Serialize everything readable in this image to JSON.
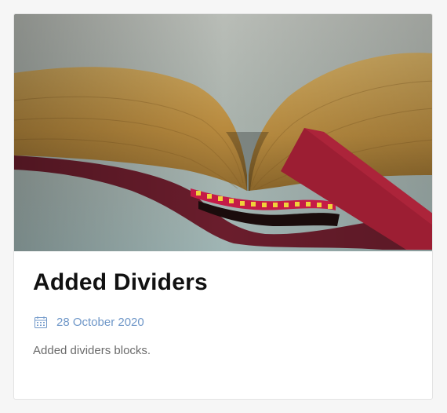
{
  "post": {
    "title": "Added Dividers",
    "date": "28 October 2020",
    "excerpt": "Added dividers blocks.",
    "image_alt": "Open book with ribbon bookmark"
  },
  "colors": {
    "accent": "#6f97c8",
    "title": "#111111",
    "text": "#6b6b6b"
  },
  "icons": {
    "date": "calendar-icon"
  }
}
